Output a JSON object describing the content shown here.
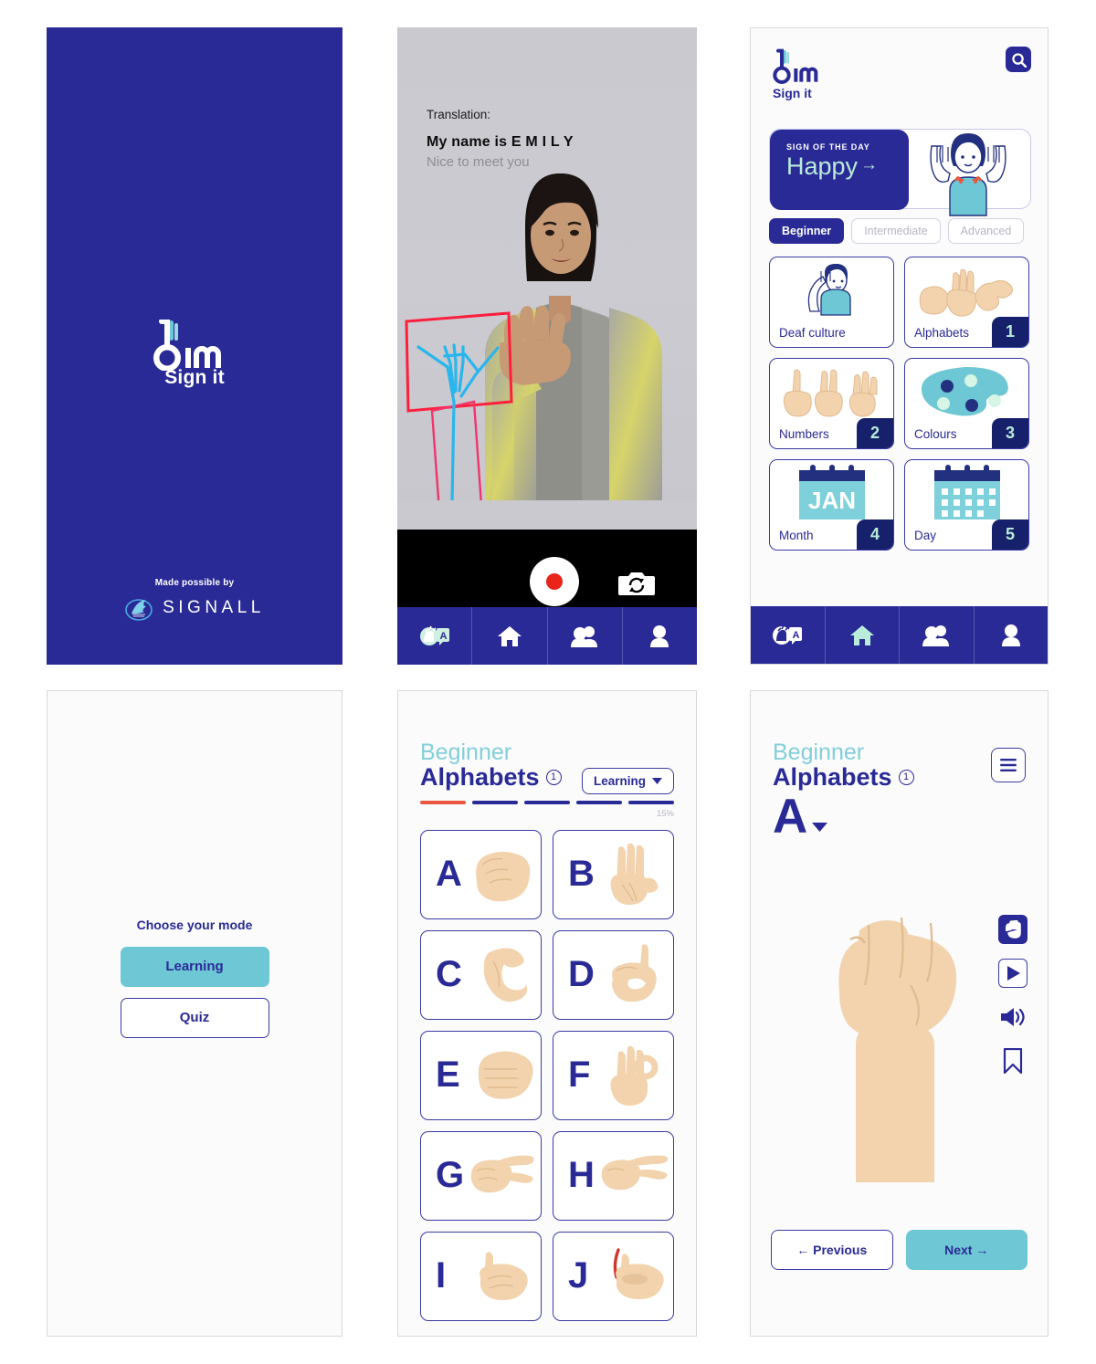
{
  "app": {
    "name": "bim",
    "tagline": "Sign it",
    "brand_navy": "#2a2a96",
    "brand_teal": "#6ec7d4",
    "brand_mint": "#b9ecd9",
    "accent_orange": "#e8573f"
  },
  "splash": {
    "logo_text": "bim",
    "logo_sub": "Sign it",
    "credit_label": "Made possible by",
    "partner_name": "SIGNALL",
    "partner_icon": "signall-hand-icon",
    "background": "#2a2a96"
  },
  "translation": {
    "label": "Translation:",
    "primary": "My name is E M I L Y",
    "secondary": "Nice to meet you",
    "record_button": "record-button",
    "flip_camera_button": "flip-camera-button",
    "overlay": {
      "box_color": "#ff1f3d",
      "skeleton_color": "#29b6ec"
    }
  },
  "tabbar": {
    "items": [
      {
        "name": "tab-translate",
        "icon": "hand-letter-a-icon",
        "active": false
      },
      {
        "name": "tab-home",
        "icon": "home-icon",
        "active": false
      },
      {
        "name": "tab-community",
        "icon": "people-icon",
        "active": false
      },
      {
        "name": "tab-profile",
        "icon": "person-icon",
        "active": false
      }
    ],
    "home_active_on_home_screen": true
  },
  "home": {
    "logo_text": "bim",
    "logo_sub": "Sign it",
    "search_icon": "search-icon",
    "sign_of_the_day": {
      "kicker": "SIGN OF THE DAY",
      "word": "Happy",
      "arrow": "→",
      "illustration": "boy-signing-happy-icon"
    },
    "levels": [
      {
        "label": "Beginner",
        "active": true
      },
      {
        "label": "Intermediate",
        "active": false
      },
      {
        "label": "Advanced",
        "active": false
      }
    ],
    "categories": [
      {
        "label": "Deaf culture",
        "badge": "",
        "icon": "deaf-culture-icon"
      },
      {
        "label": "Alphabets",
        "badge": "1",
        "icon": "alphabet-hands-icon"
      },
      {
        "label": "Numbers",
        "badge": "2",
        "icon": "number-hands-icon"
      },
      {
        "label": "Colours",
        "badge": "3",
        "icon": "palette-icon"
      },
      {
        "label": "Month",
        "badge": "4",
        "icon": "calendar-jan-icon",
        "calendar_text": "JAN"
      },
      {
        "label": "Day",
        "badge": "5",
        "icon": "calendar-days-icon"
      }
    ]
  },
  "mode_screen": {
    "title": "Choose your mode",
    "buttons": [
      {
        "label": "Learning",
        "selected": true
      },
      {
        "label": "Quiz",
        "selected": false
      }
    ]
  },
  "alphabet_list": {
    "kicker": "Beginner",
    "title": "Alphabets",
    "lesson_number": "1",
    "mode_dropdown": "Learning",
    "progress_percent": "15%",
    "progress_segments": 5,
    "progress_active_index": 0,
    "letters": [
      {
        "letter": "A",
        "hand": "fist-a-icon"
      },
      {
        "letter": "B",
        "hand": "flat-hand-b-icon"
      },
      {
        "letter": "C",
        "hand": "curve-c-icon"
      },
      {
        "letter": "D",
        "hand": "point-up-d-icon"
      },
      {
        "letter": "E",
        "hand": "claw-e-icon"
      },
      {
        "letter": "F",
        "hand": "ok-f-icon"
      },
      {
        "letter": "G",
        "hand": "pinch-g-icon"
      },
      {
        "letter": "H",
        "hand": "two-finger-h-icon"
      },
      {
        "letter": "I",
        "hand": "pinky-i-icon"
      },
      {
        "letter": "J",
        "hand": "pinky-trace-j-icon"
      }
    ]
  },
  "detail_screen": {
    "kicker": "Beginner",
    "title": "Alphabets",
    "lesson_number": "1",
    "current_letter": "A",
    "dropdown_icon": "chevron-down-icon",
    "menu_icon": "hamburger-menu-icon",
    "hand_illustration": "fist-a-icon",
    "tools": [
      {
        "name": "hand-sign-button",
        "icon": "open-hand-icon",
        "style": "filled"
      },
      {
        "name": "play-video-button",
        "icon": "play-icon",
        "style": "outlined"
      },
      {
        "name": "audio-button",
        "icon": "speaker-icon",
        "style": "plain"
      },
      {
        "name": "bookmark-button",
        "icon": "bookmark-icon",
        "style": "plain"
      }
    ],
    "previous_label": "← Previous",
    "next_label": "Next →"
  }
}
